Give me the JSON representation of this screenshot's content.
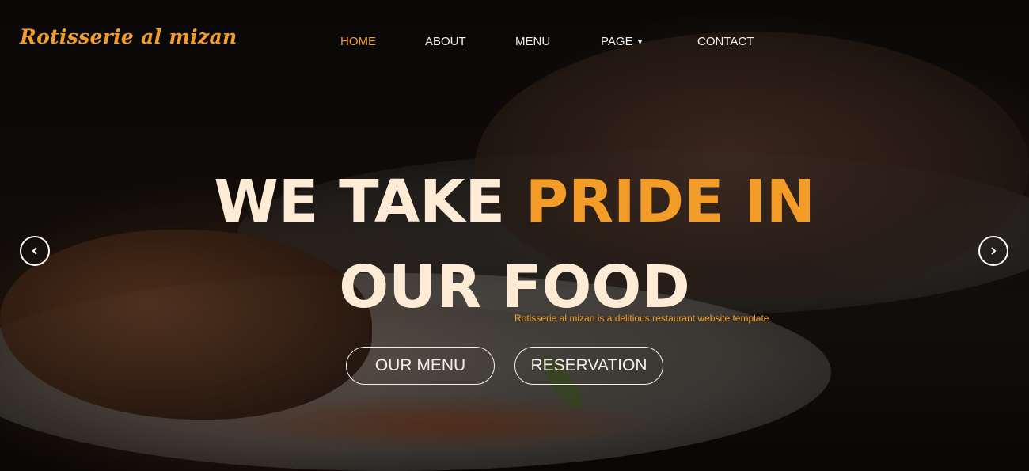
{
  "brand": {
    "name": "Rotisserie al mizan"
  },
  "nav": {
    "items": [
      {
        "label": "HOME",
        "active": true
      },
      {
        "label": "ABOUT",
        "active": false
      },
      {
        "label": "MENU",
        "active": false
      },
      {
        "label": "PAGE",
        "active": false,
        "has_dropdown": true
      },
      {
        "label": "CONTACT",
        "active": false
      }
    ]
  },
  "hero": {
    "headline_part1": "WE TAKE ",
    "headline_accent": "PRIDE IN",
    "headline_line2": "OUR FOOD",
    "subtitle": "Rotisserie al mizan is a delitious restaurant website template",
    "buttons": {
      "menu": "OUR MENU",
      "reservation": "RESERVATION"
    }
  },
  "slider": {
    "prev_icon": "chevron-left-icon",
    "next_icon": "chevron-right-icon"
  },
  "colors": {
    "accent": "#f39c28",
    "text_light": "#fdebd6"
  }
}
